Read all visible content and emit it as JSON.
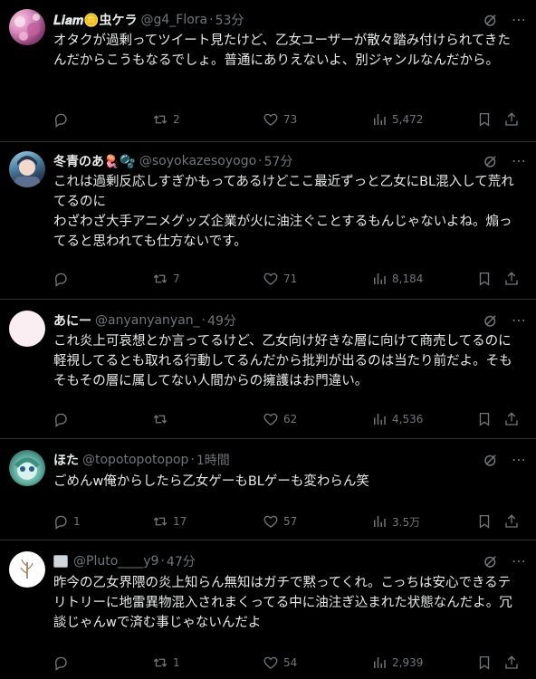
{
  "tweets": [
    {
      "name": "𝑳𝒊𝒂𝒎🪙虫ケラ",
      "handle": "@g4_Flora",
      "time": "53分",
      "text": "オタクが過剰ってツイート見たけど、乙女ユーザーが散々踏み付けられてきたんだからこうもなるでしょ。普通にありえないよ、別ジャンルなんだから。",
      "replies": "",
      "retweets": "2",
      "likes": "73",
      "views": "5,472",
      "avatar": "pink-floral-avatar"
    },
    {
      "name": "冬青のあ🪼🫧",
      "handle": "@soyokazesoyogo",
      "time": "57分",
      "text": "これは過剰反応しすぎかもってあるけどここ最近ずっと乙女にBL混入して荒れてるのに\nわざわざ大手アニメグッズ企業が火に油注ぐことするもんじゃないよね。煽ってると思われても仕方ないです。",
      "replies": "",
      "retweets": "7",
      "likes": "71",
      "views": "8,184",
      "avatar": "anime-character-avatar"
    },
    {
      "name": "あにー",
      "handle": "@anyanyanyan_",
      "time": "49分",
      "text": "これ炎上可哀想とか言ってるけど、乙女向け好きな層に向けて商売してるのに軽視してるとも取れる行動してるんだから批判が出るのは当たり前だよ。そもそもその層に属してない人間からの擁護はお門違い。",
      "replies": "",
      "retweets": "",
      "likes": "62",
      "views": "4,536",
      "avatar": "pink-blank-avatar"
    },
    {
      "name": "ほた",
      "handle": "@topotopotopop",
      "time": "1時間",
      "text": "ごめんw俺からしたら乙女ゲーもBLゲーも変わらん笑",
      "replies": "1",
      "retweets": "17",
      "likes": "57",
      "views": "3.5万",
      "avatar": "teal-character-avatar"
    },
    {
      "name": "",
      "handle": "@Pluto____y9",
      "time": "47分",
      "text": "昨今の乙女界隈の炎上知らん無知はガチで黙ってくれ。こっちは安心できるテリトリーに地雷異物混入されまくってる中に油注ぎ込まれた状態なんだよ。冗談じゃんwで済む事じゃないんだよ",
      "replies": "",
      "retweets": "1",
      "likes": "54",
      "views": "2,939",
      "avatar": "white-plant-avatar"
    }
  ],
  "colors": {
    "background": "#000000",
    "text": "#e7e9ea",
    "secondary": "#71767b",
    "divider": "#2f3336"
  }
}
